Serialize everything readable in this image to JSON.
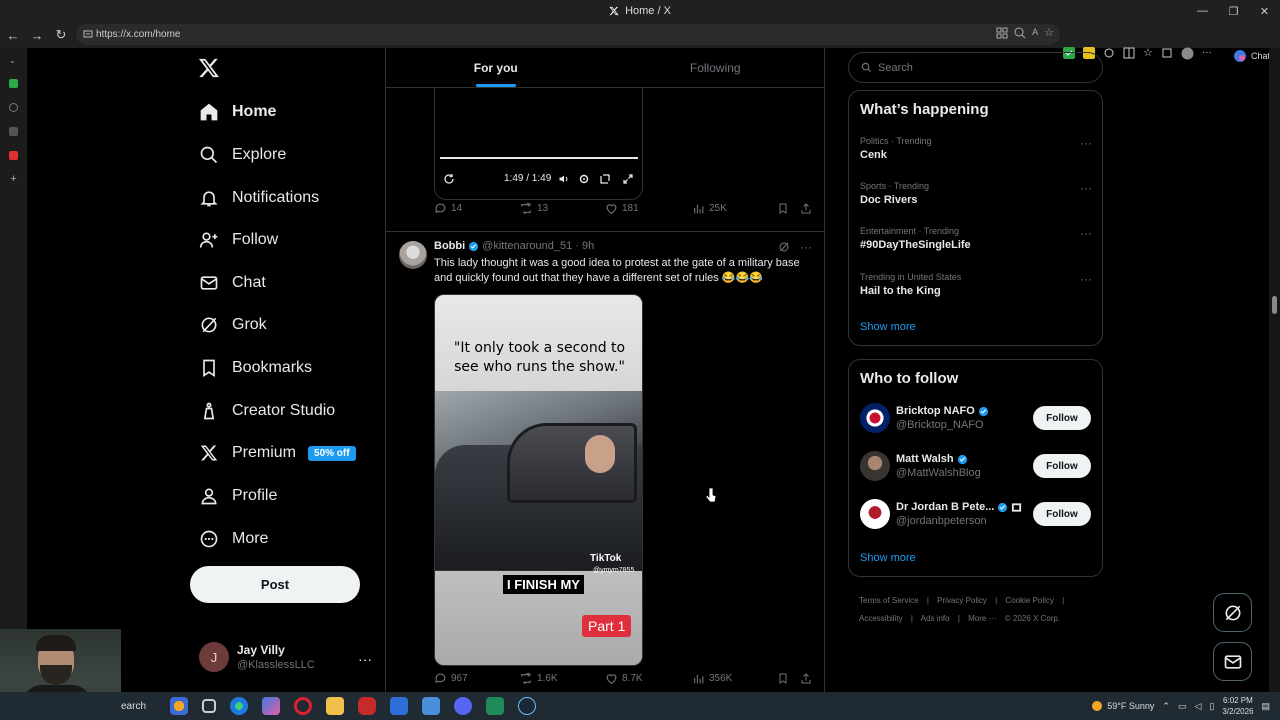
{
  "browser": {
    "tab_title": "Home / X",
    "url": "https://x.com/home",
    "chat_label": "Chat"
  },
  "nav": {
    "items": [
      {
        "label": "Home",
        "icon": "home-icon"
      },
      {
        "label": "Explore",
        "icon": "search-icon"
      },
      {
        "label": "Notifications",
        "icon": "bell-icon"
      },
      {
        "label": "Follow",
        "icon": "person-plus-icon"
      },
      {
        "label": "Chat",
        "icon": "mail-icon"
      },
      {
        "label": "Grok",
        "icon": "grok-icon"
      },
      {
        "label": "Bookmarks",
        "icon": "bookmark-icon"
      },
      {
        "label": "Creator Studio",
        "icon": "creator-icon"
      },
      {
        "label": "Premium",
        "icon": "x-logo-icon"
      },
      {
        "label": "Profile",
        "icon": "person-icon"
      },
      {
        "label": "More",
        "icon": "more-circle-icon"
      }
    ],
    "premium_badge": "50% off",
    "post_label": "Post",
    "account": {
      "initial": "J",
      "name": "Jay Villy",
      "handle": "@KlasslessLLC"
    }
  },
  "feed": {
    "tabs": [
      "For you",
      "Following"
    ],
    "video1": {
      "time": "1:49 / 1:49"
    },
    "tweet1_stats": {
      "replies": "14",
      "reposts": "13",
      "likes": "181",
      "views": "25K"
    },
    "tweet2": {
      "name": "Bobbi",
      "handle": "@kittenaround_51",
      "time": "· 9h",
      "text": "This lady thought it was a good idea to protest at the gate of a military base and quickly found out that they have a different set of rules 😂😂😂",
      "media_caption": "\"It only took a second to see who runs the show.\"",
      "media_tiktok": "TikTok",
      "media_tiktok_user": "@ymym7855",
      "media_finish": "I FINISH MY",
      "media_part": "Part 1",
      "stats": {
        "replies": "967",
        "reposts": "1.6K",
        "likes": "8.7K",
        "views": "356K"
      }
    }
  },
  "right": {
    "search_placeholder": "Search",
    "happening_title": "What’s happening",
    "trends": [
      {
        "context": "Politics · Trending",
        "topic": "Cenk"
      },
      {
        "context": "Sports · Trending",
        "topic": "Doc Rivers"
      },
      {
        "context": "Entertainment · Trending",
        "topic": "#90DayTheSingleLife"
      },
      {
        "context": "Trending in United States",
        "topic": "Hail to the King"
      }
    ],
    "show_more": "Show more",
    "who_to_follow_title": "Who to follow",
    "follow_suggestions": [
      {
        "name": "Bricktop NAFO",
        "handle": "@Bricktop_NAFO",
        "button": "Follow"
      },
      {
        "name": "Matt Walsh",
        "handle": "@MattWalshBlog",
        "button": "Follow"
      },
      {
        "name": "Dr Jordan B Pete...",
        "handle": "@jordanbpeterson",
        "button": "Follow"
      }
    ],
    "show_more_2": "Show more",
    "footer": [
      "Terms of Service",
      "|",
      "Privacy Policy",
      "|",
      "Cookie Policy",
      "|",
      "Accessibility",
      "|",
      "Ads info",
      "|",
      "More ···",
      "© 2026 X Corp."
    ]
  },
  "taskbar": {
    "search_text": "earch",
    "weather": "59°F  Sunny",
    "time": "6:02 PM",
    "date": "3/2/2026"
  },
  "colors": {
    "accent": "#1d9bf0",
    "background": "#000000",
    "border": "#2f3336",
    "muted": "#71767b"
  }
}
